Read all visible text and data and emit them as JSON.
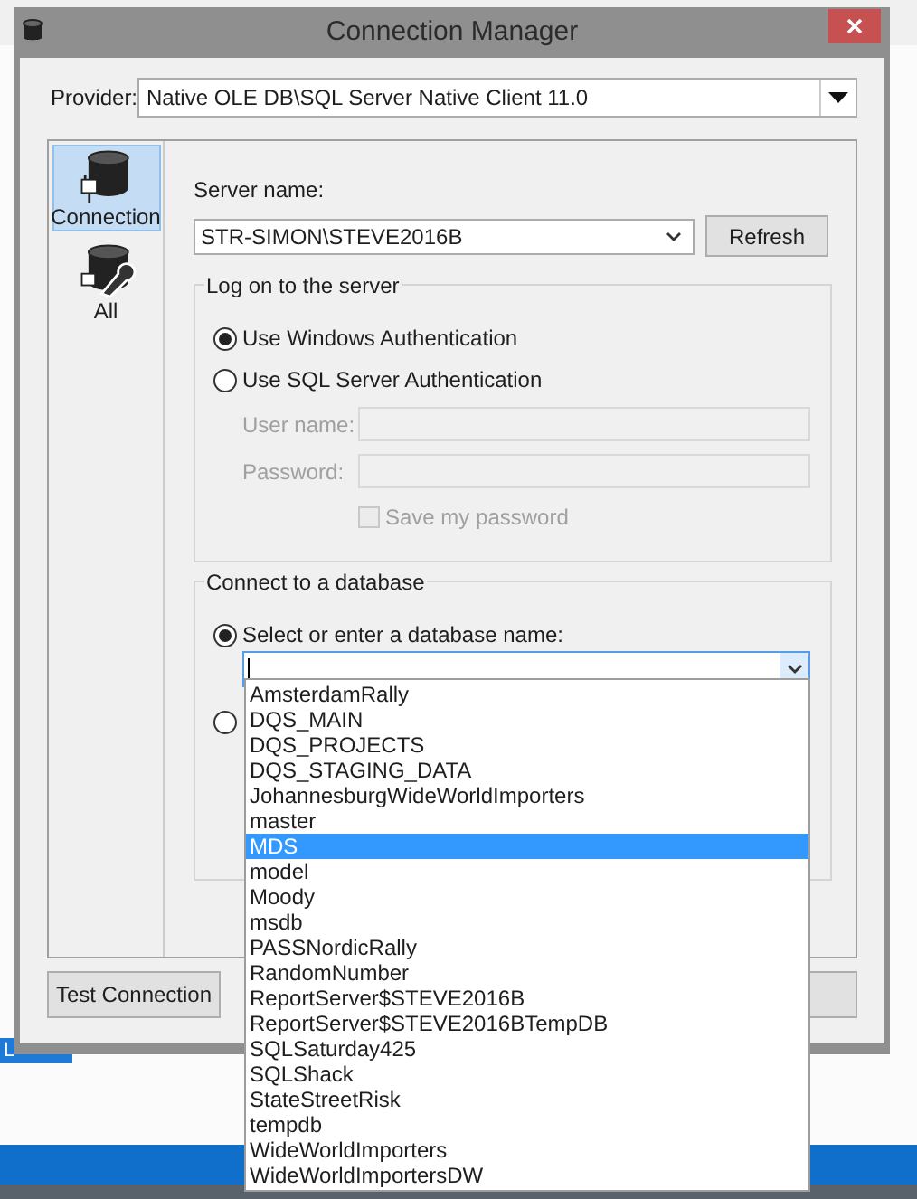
{
  "window": {
    "title": "Connection Manager"
  },
  "provider": {
    "label": "Provider:",
    "value": "Native OLE DB\\SQL Server Native Client 11.0"
  },
  "nav": [
    {
      "label": "Connection",
      "kind": "plug",
      "selected": true
    },
    {
      "label": "All",
      "kind": "wrench",
      "selected": false
    }
  ],
  "server": {
    "label": "Server name:",
    "value": "STR-SIMON\\STEVE2016B",
    "refresh": "Refresh"
  },
  "logon": {
    "title": "Log on to the server",
    "options": [
      {
        "label": "Use Windows Authentication",
        "selected": true
      },
      {
        "label": "Use SQL Server Authentication",
        "selected": false
      }
    ],
    "user_label": "User name:",
    "password_label": "Password:",
    "disabled": true,
    "save_password": {
      "label": "Save my password",
      "checked": false
    }
  },
  "database": {
    "title": "Connect to a database",
    "options": [
      {
        "label": "Select or enter a database name:",
        "selected": true
      },
      {
        "selected": false
      }
    ]
  },
  "dropdown": [
    {
      "label": "AmsterdamRally",
      "selected": false
    },
    {
      "label": "DQS_MAIN",
      "selected": false
    },
    {
      "label": "DQS_PROJECTS",
      "selected": false
    },
    {
      "label": "DQS_STAGING_DATA",
      "selected": false
    },
    {
      "label": "JohannesburgWideWorldImporters",
      "selected": false
    },
    {
      "label": "master",
      "selected": false
    },
    {
      "label": "MDS",
      "selected": true
    },
    {
      "label": "model",
      "selected": false
    },
    {
      "label": "Moody",
      "selected": false
    },
    {
      "label": "msdb",
      "selected": false
    },
    {
      "label": "PASSNordicRally",
      "selected": false
    },
    {
      "label": "RandomNumber",
      "selected": false
    },
    {
      "label": "ReportServer$STEVE2016B",
      "selected": false
    },
    {
      "label": "ReportServer$STEVE2016BTempDB",
      "selected": false
    },
    {
      "label": "SQLSaturday425",
      "selected": false
    },
    {
      "label": "SQLShack",
      "selected": false
    },
    {
      "label": "StateStreetRisk",
      "selected": false
    },
    {
      "label": "tempdb",
      "selected": false
    },
    {
      "label": "WideWorldImporters",
      "selected": false
    },
    {
      "label": "WideWorldImportersDW",
      "selected": false
    }
  ],
  "footer": {
    "test_button": "Test Connection"
  },
  "background": {
    "fragment": "L"
  }
}
